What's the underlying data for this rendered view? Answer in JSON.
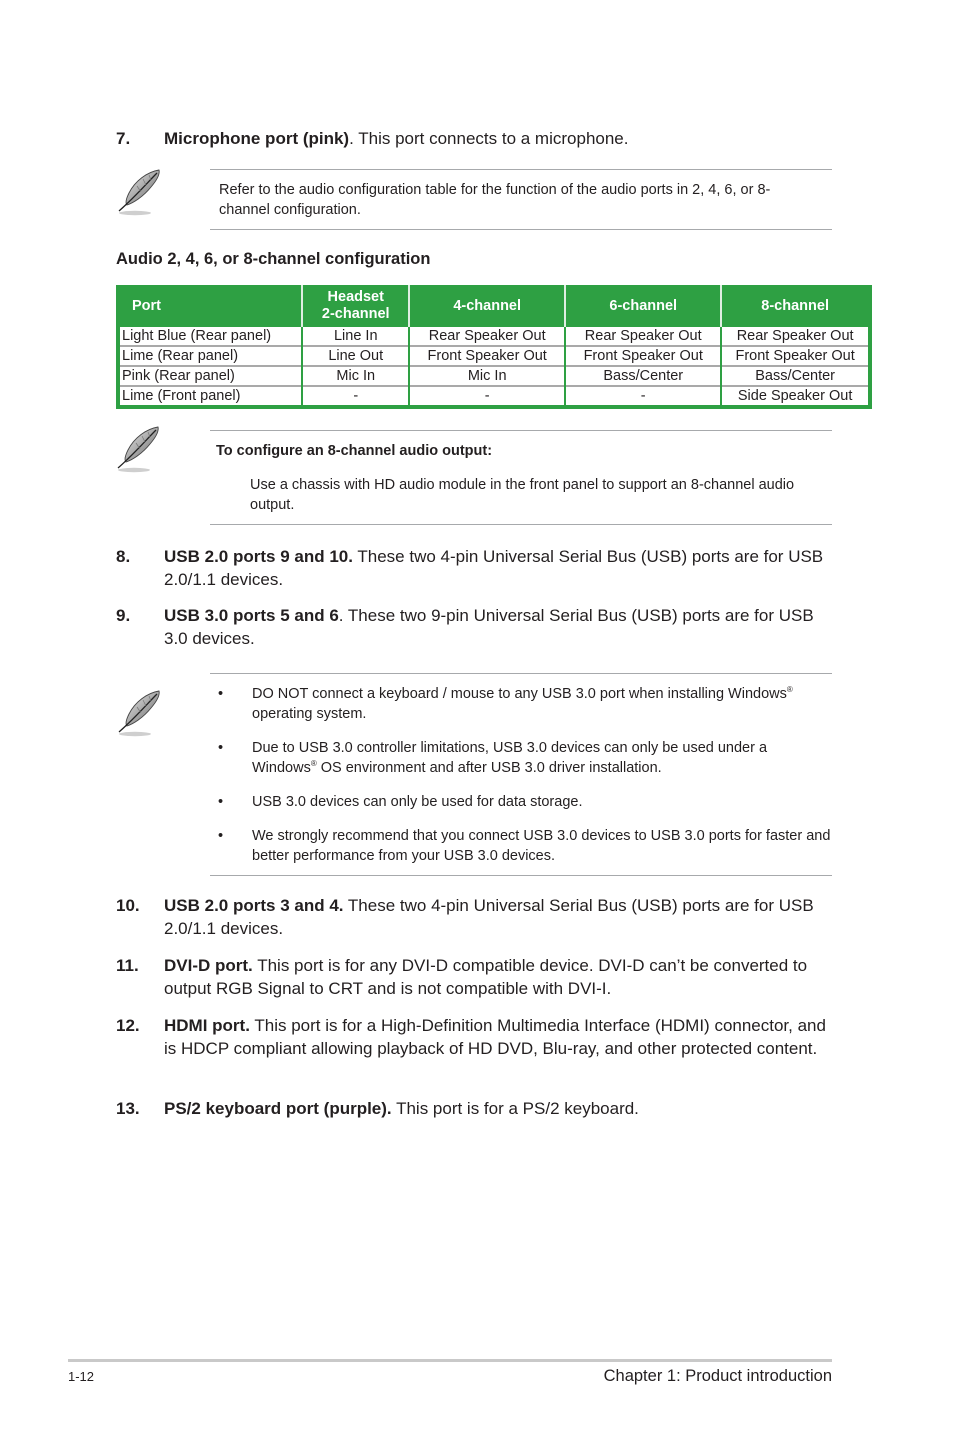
{
  "items": [
    {
      "num": "7.",
      "lead": "Microphone port (pink)",
      "rest": ". This port connects to a microphone."
    },
    {
      "num": "8.",
      "lead": "USB 2.0 ports 9 and 10.",
      "rest": " These two 4-pin Universal Serial Bus (USB) ports are for USB 2.0/1.1 devices."
    },
    {
      "num": "9.",
      "lead": "USB 3.0 ports 5 and 6",
      "rest": ". These two 9-pin Universal Serial Bus (USB) ports are for USB 3.0 devices."
    },
    {
      "num": "10.",
      "lead": "USB 2.0 ports 3 and 4.",
      "rest": " These two 4-pin Universal Serial Bus (USB) ports are for USB 2.0/1.1 devices."
    },
    {
      "num": "11.",
      "lead": "DVI-D port.",
      "rest": " This port is for any DVI-D compatible device.  DVI-D can’t be converted to output RGB Signal to CRT and is not compatible with DVI-I."
    },
    {
      "num": "12.",
      "lead": "HDMI port.",
      "rest": " This port is for a High-Definition Multimedia Interface (HDMI) connector, and is HDCP compliant allowing playback of HD DVD, Blu-ray, and other protected content."
    },
    {
      "num": "13.",
      "lead": "PS/2 keyboard port (purple).",
      "rest": " This port is for a PS/2 keyboard."
    }
  ],
  "note1": {
    "icon": "feather-pen-icon",
    "text": "Refer to the audio configuration table for the function of the audio ports in 2, 4, 6, or 8-channel configuration."
  },
  "table": {
    "title": "Audio 2, 4, 6, or 8-channel configuration",
    "header_color": "#2ea043",
    "headers": [
      "Port",
      "Headset 2-channel",
      "4-channel",
      "6-channel",
      "8-channel"
    ],
    "header_line1": "Headset",
    "header_line2": "2-channel",
    "rows": [
      [
        "Light Blue (Rear panel)",
        "Line In",
        "Rear Speaker Out",
        "Rear Speaker Out",
        "Rear Speaker Out"
      ],
      [
        "Lime (Rear panel)",
        "Line Out",
        "Front Speaker Out",
        "Front Speaker Out",
        "Front Speaker Out"
      ],
      [
        "Pink (Rear panel)",
        "Mic In",
        "Mic In",
        "Bass/Center",
        "Bass/Center"
      ],
      [
        "Lime (Front panel)",
        "-",
        "-",
        "-",
        "Side Speaker Out"
      ]
    ]
  },
  "note2": {
    "icon": "feather-pen-icon",
    "heading": "To configure an 8-channel audio output:",
    "text": "Use a chassis with HD audio module in the front panel to support an 8-channel audio output."
  },
  "note3": {
    "icon": "feather-pen-icon",
    "bullet_glyph": "•",
    "bullets": [
      {
        "before": "DO NOT connect a keyboard / mouse to any USB 3.0 port when installing Windows",
        "sup": "®",
        "after": " operating system."
      },
      {
        "before": "Due to USB 3.0 controller limitations, USB 3.0 devices can only be used under a Windows",
        "sup": "®",
        "after": " OS environment and after USB 3.0 driver installation."
      },
      {
        "before": "USB 3.0 devices can only be used for data storage.",
        "sup": "",
        "after": ""
      },
      {
        "before": "We strongly recommend that you connect USB 3.0 devices to USB 3.0 ports for faster and better performance from your USB 3.0 devices.",
        "sup": "",
        "after": ""
      }
    ]
  },
  "footer": {
    "page_number": "1-12",
    "chapter": "Chapter 1: Product introduction"
  }
}
